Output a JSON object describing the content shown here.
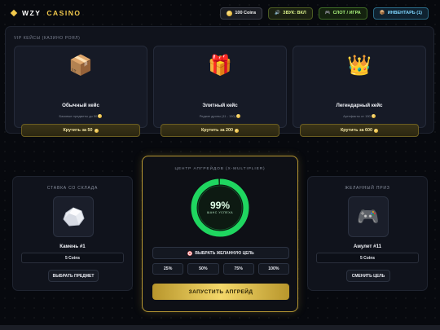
{
  "header": {
    "logo_left": "WZY",
    "logo_right": "CASINO",
    "coins_label": "100 Coins",
    "sound_label": "ЗВУК: ВКЛ",
    "mode_label": "СЛОТ / ИГРА",
    "inventory_label": "ИНВЕНТАРЬ (1)"
  },
  "cases": {
    "title": "VIP КЕЙСЫ (КАЗИНО РОЯЛ)",
    "items": [
      {
        "emoji": "📦",
        "name": "Обычный кейс",
        "desc": "Базовые предметы до 50",
        "button": "Крутить за 50"
      },
      {
        "emoji": "🎁",
        "name": "Элитный кейс",
        "desc": "Редкие дропы (11 - 150)",
        "button": "Крутить за 200"
      },
      {
        "emoji": "👑",
        "name": "Легендарный кейс",
        "desc": "Артефакты от 150",
        "button": "Крутить за 600"
      }
    ]
  },
  "left": {
    "title": "СТАВКА СО СКЛАДА",
    "item_name": "Камень #1",
    "price": "5 Coins",
    "button": "ВЫБРАТЬ ПРЕДМЕТ"
  },
  "center": {
    "title": "ЦЕНТР АПГРЕЙДОВ (X-MULTIPLIER)",
    "chance_value": "99%",
    "chance_label": "ШАНС УСПЕХА",
    "chance_fraction": 0.99,
    "target_button": "ВЫБРАТЬ ЖЕЛАННУЮ ЦЕЛЬ",
    "percent_buttons": [
      "25%",
      "50%",
      "75%",
      "100%"
    ],
    "launch_button": "ЗАПУСТИТЬ АПГРЕЙД"
  },
  "right": {
    "title": "ЖЕЛАННЫЙ ПРИЗ",
    "emoji": "🎮",
    "item_name": "Амулет #11",
    "price": "5 Coins",
    "button": "СМЕНИТЬ ЦЕЛЬ"
  },
  "colors": {
    "accent_gold": "#f2c94c",
    "success_green": "#1fd660",
    "panel_bg": "#10131c"
  }
}
